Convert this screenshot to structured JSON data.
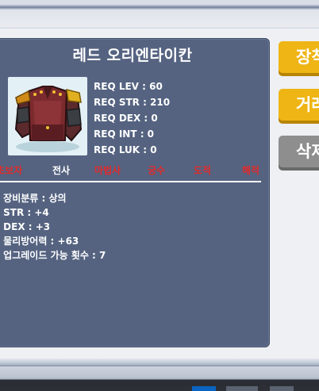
{
  "item": {
    "name": "레드 오리엔타이칸",
    "requirements": [
      "REQ LEV : 60",
      "REQ STR : 210",
      "REQ DEX : 0",
      "REQ INT : 0",
      "REQ LUK : 0"
    ],
    "jobs": [
      {
        "label": "초보자",
        "allowed": false
      },
      {
        "label": "전사",
        "allowed": true
      },
      {
        "label": "마법사",
        "allowed": false
      },
      {
        "label": "궁수",
        "allowed": false
      },
      {
        "label": "도적",
        "allowed": false
      },
      {
        "label": "해적",
        "allowed": false
      }
    ],
    "stats": [
      "- 장비분류 : 상의",
      "- STR : +4",
      "- DEX : +3",
      "- 물리방어력 : +63",
      "- 업그레이드 가능 횟수 : 7"
    ],
    "image_icon": "red-armor-top-icon"
  },
  "buttons": {
    "equip": "장착",
    "trade": "거래",
    "delete": "삭제"
  },
  "colors": {
    "card_bg": "#556381",
    "allowed_job": "#ffffff",
    "disallowed_job": "#e02a2a",
    "primary_button": "#efb514",
    "disabled_button": "#8e8e8e"
  }
}
